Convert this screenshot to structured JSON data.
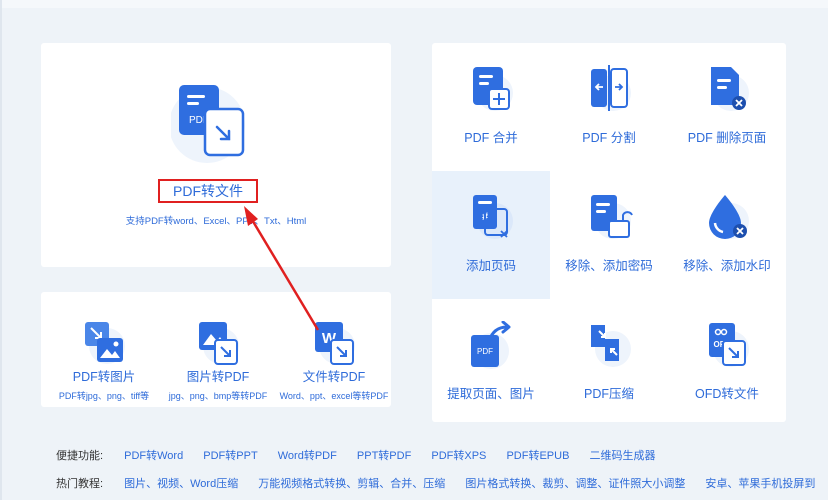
{
  "main_tool": {
    "title": "PDF转文件",
    "subtitle": "支持PDF转word、Excel、PPT、Txt、Html",
    "icon": "pdf-to-file-icon",
    "icon_text": "PDF"
  },
  "small_tools": [
    {
      "label": "PDF转图片",
      "desc": "PDF转jpg、png、tiff等",
      "icon": "pdf-to-image-icon"
    },
    {
      "label": "图片转PDF",
      "desc": "jpg、png、bmp等转PDF",
      "icon": "image-to-pdf-icon"
    },
    {
      "label": "文件转PDF",
      "desc": "Word、ppt、excel等转PDF",
      "icon": "file-to-pdf-icon",
      "icon_text": "W"
    }
  ],
  "grid_tools": [
    {
      "label": "PDF 合并",
      "icon": "pdf-merge-icon"
    },
    {
      "label": "PDF 分割",
      "icon": "pdf-split-icon"
    },
    {
      "label": "PDF 删除页面",
      "icon": "pdf-delete-page-icon"
    },
    {
      "label": "添加页码",
      "icon": "add-page-number-icon"
    },
    {
      "label": "移除、添加密码",
      "icon": "password-lock-icon"
    },
    {
      "label": "移除、添加水印",
      "icon": "watermark-drop-icon"
    },
    {
      "label": "提取页面、图片",
      "icon": "extract-page-icon",
      "icon_text": "PDF"
    },
    {
      "label": "PDF压缩",
      "icon": "pdf-compress-icon"
    },
    {
      "label": "OFD转文件",
      "icon": "ofd-to-file-icon",
      "icon_text": "OFD"
    }
  ],
  "quick_links": {
    "label": "便捷功能:",
    "items": [
      "PDF转Word",
      "PDF转PPT",
      "Word转PDF",
      "PPT转PDF",
      "PDF转XPS",
      "PDF转EPUB",
      "二维码生成器"
    ]
  },
  "hot_tutorials": {
    "label": "热门教程:",
    "items": [
      "图片、视频、Word压缩",
      "万能视频格式转换、剪辑、合并、压缩",
      "图片格式转换、裁剪、调整、证件照大小调整",
      "安卓、苹果手机投屏到"
    ]
  },
  "colors": {
    "accent": "#2e6bd9",
    "highlight": "#e02020",
    "active_bg": "#e8f1fb"
  }
}
